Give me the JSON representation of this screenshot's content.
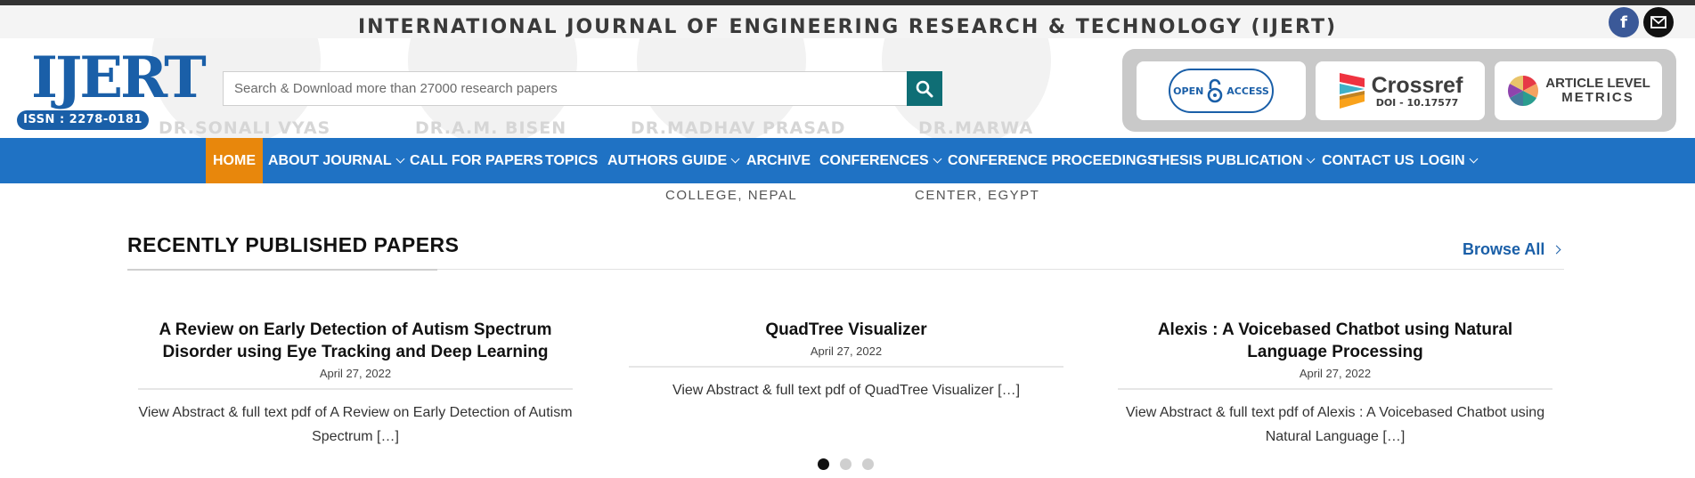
{
  "site": {
    "title": "INTERNATIONAL JOURNAL OF ENGINEERING RESEARCH & TECHNOLOGY (IJERT)"
  },
  "social": {
    "facebook_icon": "facebook-icon",
    "email_icon": "email-icon"
  },
  "logo": {
    "word": "IJERT",
    "issn": "ISSN : 2278-0181"
  },
  "search": {
    "placeholder": "Search & Download more than 27000 research papers",
    "value": ""
  },
  "badges": {
    "open_access_top": "OPEN",
    "open_access_bottom": "ACCESS",
    "crossref_name": "Crossref",
    "crossref_doi": "DOI - 10.17577",
    "alm_line1": "ARTICLE LEVEL",
    "alm_line2": "METRICS"
  },
  "ghost_people": [
    {
      "name": "DR.SONALI VYAS"
    },
    {
      "name": "DR.A.M. BISEN"
    },
    {
      "name": "DR.MADHAV PRASAD"
    },
    {
      "name": "DR.MARWA"
    }
  ],
  "ghost_subtext": [
    "COLLEGE, NEPAL",
    "CENTER, EGYPT"
  ],
  "nav": {
    "items": [
      {
        "label": "HOME",
        "dropdown": false,
        "active": true
      },
      {
        "label": "ABOUT JOURNAL",
        "dropdown": true
      },
      {
        "label": "CALL FOR PAPERS",
        "dropdown": false
      },
      {
        "label": "TOPICS",
        "dropdown": false
      },
      {
        "label": "AUTHORS GUIDE",
        "dropdown": true
      },
      {
        "label": "ARCHIVE",
        "dropdown": false
      },
      {
        "label": "CONFERENCES",
        "dropdown": true
      },
      {
        "label": "CONFERENCE PROCEEDINGS",
        "dropdown": false
      },
      {
        "label": "THESIS PUBLICATION",
        "dropdown": true
      },
      {
        "label": "CONTACT US",
        "dropdown": false
      },
      {
        "label": "LOGIN",
        "dropdown": true
      }
    ]
  },
  "recent": {
    "heading": "RECENTLY PUBLISHED PAPERS",
    "browse_all": "Browse All",
    "papers": [
      {
        "title": "A Review on Early Detection of Autism Spectrum Disorder using Eye Tracking and Deep Learning",
        "date": "April 27, 2022",
        "excerpt": "View Abstract & full text pdf of A Review on Early Detection of Autism Spectrum […]"
      },
      {
        "title": "QuadTree Visualizer",
        "date": "April 27, 2022",
        "excerpt": "View Abstract & full text pdf of QuadTree Visualizer […]"
      },
      {
        "title": "Alexis : A Voicebased Chatbot using Natural Language Processing",
        "date": "April 27, 2022",
        "excerpt": "View Abstract & full text pdf of Alexis : A Voicebased Chatbot using Natural Language […]"
      }
    ]
  },
  "carousel": {
    "pages": 3,
    "active_page": 1
  },
  "colors": {
    "nav_bg": "#1f72c4",
    "nav_active": "#e8870c",
    "brand_blue": "#1a5fa8",
    "search_button": "#0f6e75"
  }
}
